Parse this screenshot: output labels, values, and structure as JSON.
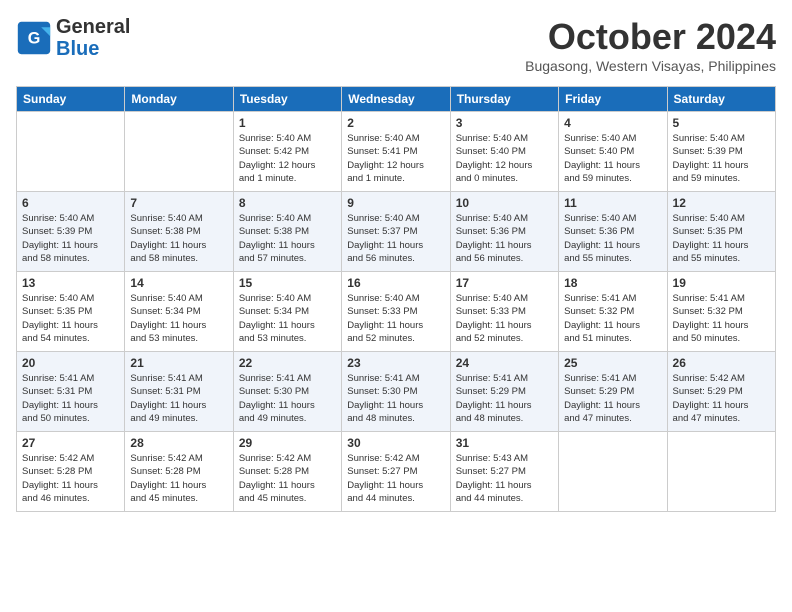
{
  "header": {
    "logo_line1": "General",
    "logo_line2": "Blue",
    "month": "October 2024",
    "location": "Bugasong, Western Visayas, Philippines"
  },
  "days_of_week": [
    "Sunday",
    "Monday",
    "Tuesday",
    "Wednesday",
    "Thursday",
    "Friday",
    "Saturday"
  ],
  "weeks": [
    [
      {
        "day": "",
        "content": ""
      },
      {
        "day": "",
        "content": ""
      },
      {
        "day": "1",
        "content": "Sunrise: 5:40 AM\nSunset: 5:42 PM\nDaylight: 12 hours\nand 1 minute."
      },
      {
        "day": "2",
        "content": "Sunrise: 5:40 AM\nSunset: 5:41 PM\nDaylight: 12 hours\nand 1 minute."
      },
      {
        "day": "3",
        "content": "Sunrise: 5:40 AM\nSunset: 5:40 PM\nDaylight: 12 hours\nand 0 minutes."
      },
      {
        "day": "4",
        "content": "Sunrise: 5:40 AM\nSunset: 5:40 PM\nDaylight: 11 hours\nand 59 minutes."
      },
      {
        "day": "5",
        "content": "Sunrise: 5:40 AM\nSunset: 5:39 PM\nDaylight: 11 hours\nand 59 minutes."
      }
    ],
    [
      {
        "day": "6",
        "content": "Sunrise: 5:40 AM\nSunset: 5:39 PM\nDaylight: 11 hours\nand 58 minutes."
      },
      {
        "day": "7",
        "content": "Sunrise: 5:40 AM\nSunset: 5:38 PM\nDaylight: 11 hours\nand 58 minutes."
      },
      {
        "day": "8",
        "content": "Sunrise: 5:40 AM\nSunset: 5:38 PM\nDaylight: 11 hours\nand 57 minutes."
      },
      {
        "day": "9",
        "content": "Sunrise: 5:40 AM\nSunset: 5:37 PM\nDaylight: 11 hours\nand 56 minutes."
      },
      {
        "day": "10",
        "content": "Sunrise: 5:40 AM\nSunset: 5:36 PM\nDaylight: 11 hours\nand 56 minutes."
      },
      {
        "day": "11",
        "content": "Sunrise: 5:40 AM\nSunset: 5:36 PM\nDaylight: 11 hours\nand 55 minutes."
      },
      {
        "day": "12",
        "content": "Sunrise: 5:40 AM\nSunset: 5:35 PM\nDaylight: 11 hours\nand 55 minutes."
      }
    ],
    [
      {
        "day": "13",
        "content": "Sunrise: 5:40 AM\nSunset: 5:35 PM\nDaylight: 11 hours\nand 54 minutes."
      },
      {
        "day": "14",
        "content": "Sunrise: 5:40 AM\nSunset: 5:34 PM\nDaylight: 11 hours\nand 53 minutes."
      },
      {
        "day": "15",
        "content": "Sunrise: 5:40 AM\nSunset: 5:34 PM\nDaylight: 11 hours\nand 53 minutes."
      },
      {
        "day": "16",
        "content": "Sunrise: 5:40 AM\nSunset: 5:33 PM\nDaylight: 11 hours\nand 52 minutes."
      },
      {
        "day": "17",
        "content": "Sunrise: 5:40 AM\nSunset: 5:33 PM\nDaylight: 11 hours\nand 52 minutes."
      },
      {
        "day": "18",
        "content": "Sunrise: 5:41 AM\nSunset: 5:32 PM\nDaylight: 11 hours\nand 51 minutes."
      },
      {
        "day": "19",
        "content": "Sunrise: 5:41 AM\nSunset: 5:32 PM\nDaylight: 11 hours\nand 50 minutes."
      }
    ],
    [
      {
        "day": "20",
        "content": "Sunrise: 5:41 AM\nSunset: 5:31 PM\nDaylight: 11 hours\nand 50 minutes."
      },
      {
        "day": "21",
        "content": "Sunrise: 5:41 AM\nSunset: 5:31 PM\nDaylight: 11 hours\nand 49 minutes."
      },
      {
        "day": "22",
        "content": "Sunrise: 5:41 AM\nSunset: 5:30 PM\nDaylight: 11 hours\nand 49 minutes."
      },
      {
        "day": "23",
        "content": "Sunrise: 5:41 AM\nSunset: 5:30 PM\nDaylight: 11 hours\nand 48 minutes."
      },
      {
        "day": "24",
        "content": "Sunrise: 5:41 AM\nSunset: 5:29 PM\nDaylight: 11 hours\nand 48 minutes."
      },
      {
        "day": "25",
        "content": "Sunrise: 5:41 AM\nSunset: 5:29 PM\nDaylight: 11 hours\nand 47 minutes."
      },
      {
        "day": "26",
        "content": "Sunrise: 5:42 AM\nSunset: 5:29 PM\nDaylight: 11 hours\nand 47 minutes."
      }
    ],
    [
      {
        "day": "27",
        "content": "Sunrise: 5:42 AM\nSunset: 5:28 PM\nDaylight: 11 hours\nand 46 minutes."
      },
      {
        "day": "28",
        "content": "Sunrise: 5:42 AM\nSunset: 5:28 PM\nDaylight: 11 hours\nand 45 minutes."
      },
      {
        "day": "29",
        "content": "Sunrise: 5:42 AM\nSunset: 5:28 PM\nDaylight: 11 hours\nand 45 minutes."
      },
      {
        "day": "30",
        "content": "Sunrise: 5:42 AM\nSunset: 5:27 PM\nDaylight: 11 hours\nand 44 minutes."
      },
      {
        "day": "31",
        "content": "Sunrise: 5:43 AM\nSunset: 5:27 PM\nDaylight: 11 hours\nand 44 minutes."
      },
      {
        "day": "",
        "content": ""
      },
      {
        "day": "",
        "content": ""
      }
    ]
  ]
}
